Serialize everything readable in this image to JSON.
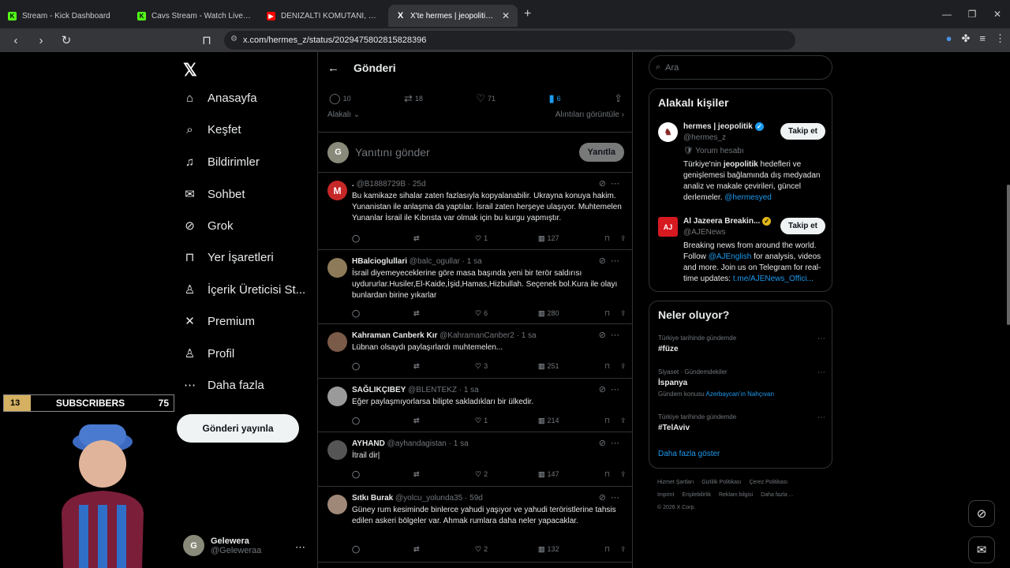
{
  "browser": {
    "tabs": [
      {
        "title": "Stream - Kick Dashboard",
        "fav": "K",
        "fav_color": "#53fc18"
      },
      {
        "title": "Cavs Stream - Watch Live on Kick",
        "fav": "K",
        "fav_color": "#53fc18"
      },
      {
        "title": "DENİZALTI KOMUTANI, DENİZALTI SA",
        "fav": "▶",
        "fav_color": "#ff0000"
      },
      {
        "title": "X'te hermes | jeopolitik: \"İngili",
        "fav": "X",
        "fav_color": "#ffffff"
      }
    ],
    "url": "x.com/hermes_z/status/2029475802815828396"
  },
  "nav": {
    "items": [
      {
        "label": "Anasayfa",
        "icon": "home-icon",
        "glyph": "⌂"
      },
      {
        "label": "Keşfet",
        "icon": "search-icon",
        "glyph": "⌕"
      },
      {
        "label": "Bildirimler",
        "icon": "bell-icon",
        "glyph": "♫"
      },
      {
        "label": "Sohbet",
        "icon": "mail-icon",
        "glyph": "✉"
      },
      {
        "label": "Grok",
        "icon": "grok-icon",
        "glyph": "⊘"
      },
      {
        "label": "Yer İşaretleri",
        "icon": "bookmark-icon",
        "glyph": "⊓"
      },
      {
        "label": "İçerik Üreticisi St...",
        "icon": "creator-icon",
        "glyph": "♙"
      },
      {
        "label": "Premium",
        "icon": "x-icon",
        "glyph": "✕"
      },
      {
        "label": "Profil",
        "icon": "person-icon",
        "glyph": "♙"
      },
      {
        "label": "Daha fazla",
        "icon": "more-circle-icon",
        "glyph": "⋯"
      }
    ],
    "post_button": "Gönderi yayınla",
    "user": {
      "name": "Gelewera",
      "handle": "@Geleweraa"
    }
  },
  "overlay": {
    "left": "13",
    "center": "SUBSCRIBERS",
    "right": "75"
  },
  "post": {
    "header": "Gönderi",
    "replies": "10",
    "reposts": "18",
    "likes": "71",
    "bookmarks": "6",
    "sort": "Alakalı",
    "quotes_link": "Alıntıları görüntüle",
    "reply_placeholder": "Yanıtını gönder",
    "reply_button": "Yanıtla"
  },
  "tweets": [
    {
      "name": ".",
      "handle": "@B1888729B · 25d",
      "text": "Bu kamikaze sihalar zaten fazlasıyla kopyalanabilir. Ukrayna konuya hakim. Yunanistan ile anlaşma da yaptılar. İsrail zaten herşeye ulaşıyor. Muhtemelen Yunanlar İsrail ile Kıbrısta var olmak için bu kurgu yapmıştır.",
      "replies": "",
      "retweets": "",
      "likes": "1",
      "views": "127",
      "avatar": "M",
      "avatar_color": "#c62828"
    },
    {
      "name": "HBalcioglullari",
      "handle": "@balc_ogullar · 1 sa",
      "text": "İsrail diyemeyeceklerine göre masa başında yeni bir terör saldırısı uydururlar.Husiler,El-Kaide,İşid,Hamas,Hizbullah. Seçenek bol.Kura ile olayı bunlardan birine yıkarlar",
      "replies": "",
      "retweets": "",
      "likes": "6",
      "views": "280",
      "avatar": "",
      "avatar_color": "#8d7a58"
    },
    {
      "name": "Kahraman Canberk Kır",
      "handle": "@KahramanCanber2 · 1 sa",
      "text": "Lübnan olsaydı paylaşırlardı muhtemelen...",
      "replies": "",
      "retweets": "",
      "likes": "3",
      "views": "251",
      "avatar": "",
      "avatar_color": "#7a5a48"
    },
    {
      "name": "SAĞLIKÇIBEY",
      "handle": "@BLENTEKZ · 1 sa",
      "text": "Eğer paylaşmıyorlarsa bilipte sakladıkları bir ülkedir.",
      "replies": "",
      "retweets": "",
      "likes": "1",
      "views": "214",
      "avatar": "",
      "avatar_color": "#9a9a9a"
    },
    {
      "name": "AYHAND",
      "handle": "@ayhandagistan · 1 sa",
      "text": "İtrail dir|",
      "replies": "",
      "retweets": "",
      "likes": "2",
      "views": "147",
      "avatar": "",
      "avatar_color": "#555"
    },
    {
      "name": "Sıtkı Burak",
      "handle": "@yolcu_yolunda35 · 59d",
      "text": "Güney rum kesiminde binlerce yahudi yaşıyor ve yahudi teröristlerine tahsis edilen askeri bölgeler var. Ahmak rumlara daha neler yapacaklar.",
      "replies": "",
      "retweets": "",
      "likes": "2",
      "views": "132",
      "avatar": "",
      "avatar_color": "#a08878"
    }
  ],
  "sidebar": {
    "search_placeholder": "Ara",
    "related_title": "Alakalı kişiler",
    "people": [
      {
        "name": "hermes | jeopolitik",
        "handle": "@hermes_z",
        "note": "Yorum hesabı",
        "bio_1": "Türkiye'nin ",
        "bio_bold": "jeopolitik",
        "bio_2": " hedefleri ve genişlemesi bağlamında dış medyadan analiz ve makale çevirileri, güncel derlemeler. ",
        "bio_link": "@hermesyed",
        "follow": "Takip et"
      },
      {
        "name": "Al Jazeera Breakin...",
        "handle": "@AJENews",
        "bio_1": "Breaking news from around the world. Follow ",
        "bio_link": "@AJEnglish",
        "bio_2": " for analysis, videos and more. Join us on Telegram for real-time updates: ",
        "bio_link2": "t.me/AJENews_Offici...",
        "follow": "Takip et"
      }
    ],
    "trends_title": "Neler oluyor?",
    "trends": [
      {
        "context": "Türkiye tarihinde gündemde",
        "name": "#füze",
        "sub": ""
      },
      {
        "context": "Siyaset · Gündemdekiler",
        "name": "İspanya",
        "sub_prefix": "Gündem konusu ",
        "sub_link": "Azerbaycan'ın Nahçıvan"
      },
      {
        "context": "Türkiye tarihinde gündemde",
        "name": "#TelAviv",
        "sub": ""
      }
    ],
    "show_more": "Daha fazla göster",
    "footer": [
      "Hizmet Şartları",
      "Gizlilik Politikası",
      "Çerez Politikası",
      "Imprint",
      "Erişilebilirlik",
      "Reklam bilgisi",
      "Daha fazla ...",
      "© 2026 X Corp."
    ]
  }
}
